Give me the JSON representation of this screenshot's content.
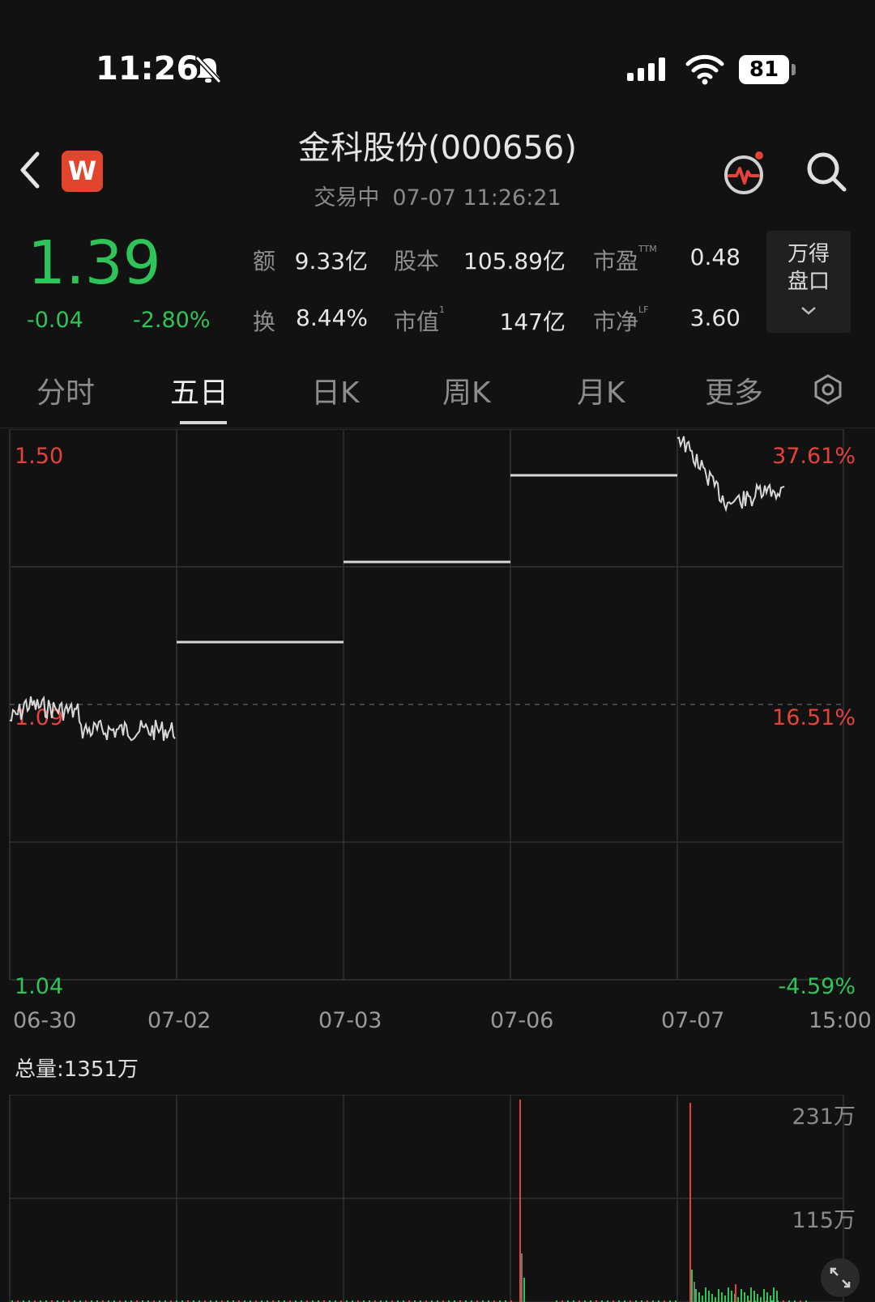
{
  "status_bar": {
    "time": "11:26",
    "battery": "81"
  },
  "header": {
    "logo_letter": "W",
    "title": "金科股份(000656)",
    "status": "交易中",
    "datetime": "07-07 11:26:21"
  },
  "quote": {
    "price": "1.39",
    "change": "-0.04",
    "change_pct": "-2.80%",
    "stats": [
      {
        "label": "额",
        "sup": "",
        "value": "9.33亿"
      },
      {
        "label": "股本",
        "sup": "",
        "value": "105.89亿"
      },
      {
        "label": "市盈",
        "sup": "TTM",
        "value": "0.48"
      },
      {
        "label": "换",
        "sup": "",
        "value": "8.44%"
      },
      {
        "label": "市值",
        "sup": "1",
        "value": "147亿"
      },
      {
        "label": "市净",
        "sup": "LF",
        "value": "3.60"
      }
    ],
    "panel": {
      "line1": "万得",
      "line2": "盘口"
    }
  },
  "tabs": [
    {
      "label": "分时",
      "active": false
    },
    {
      "label": "五日",
      "active": true
    },
    {
      "label": "日K",
      "active": false
    },
    {
      "label": "周K",
      "active": false
    },
    {
      "label": "月K",
      "active": false
    },
    {
      "label": "更多",
      "active": false
    }
  ],
  "colors": {
    "up": "#e5423a",
    "down": "#2fc35a",
    "line": "#d8d8d8",
    "grid": "#333333"
  },
  "chart_data": {
    "type": "line",
    "price_axis": {
      "top": "1.50",
      "mid": "1.09",
      "bottom": "1.04"
    },
    "pct_axis": {
      "top": "37.61%",
      "mid": "16.51%",
      "bottom": "-4.59%"
    },
    "x_labels": [
      "06-30",
      "07-02",
      "07-03",
      "07-06",
      "07-07",
      "15:00"
    ],
    "segments": [
      {
        "day": "06-30",
        "approx_range": [
          1.28,
          1.31
        ]
      },
      {
        "day": "07-02",
        "approx_value": 1.38
      },
      {
        "day": "07-03",
        "approx_value": 1.46
      },
      {
        "day": "07-06",
        "approx_value": 1.5
      },
      {
        "day": "07-07",
        "approx_range": [
          1.41,
          1.47
        ]
      }
    ],
    "volume": {
      "title": "总量:1351万",
      "axis_top": "231万",
      "axis_mid": "115万"
    }
  }
}
